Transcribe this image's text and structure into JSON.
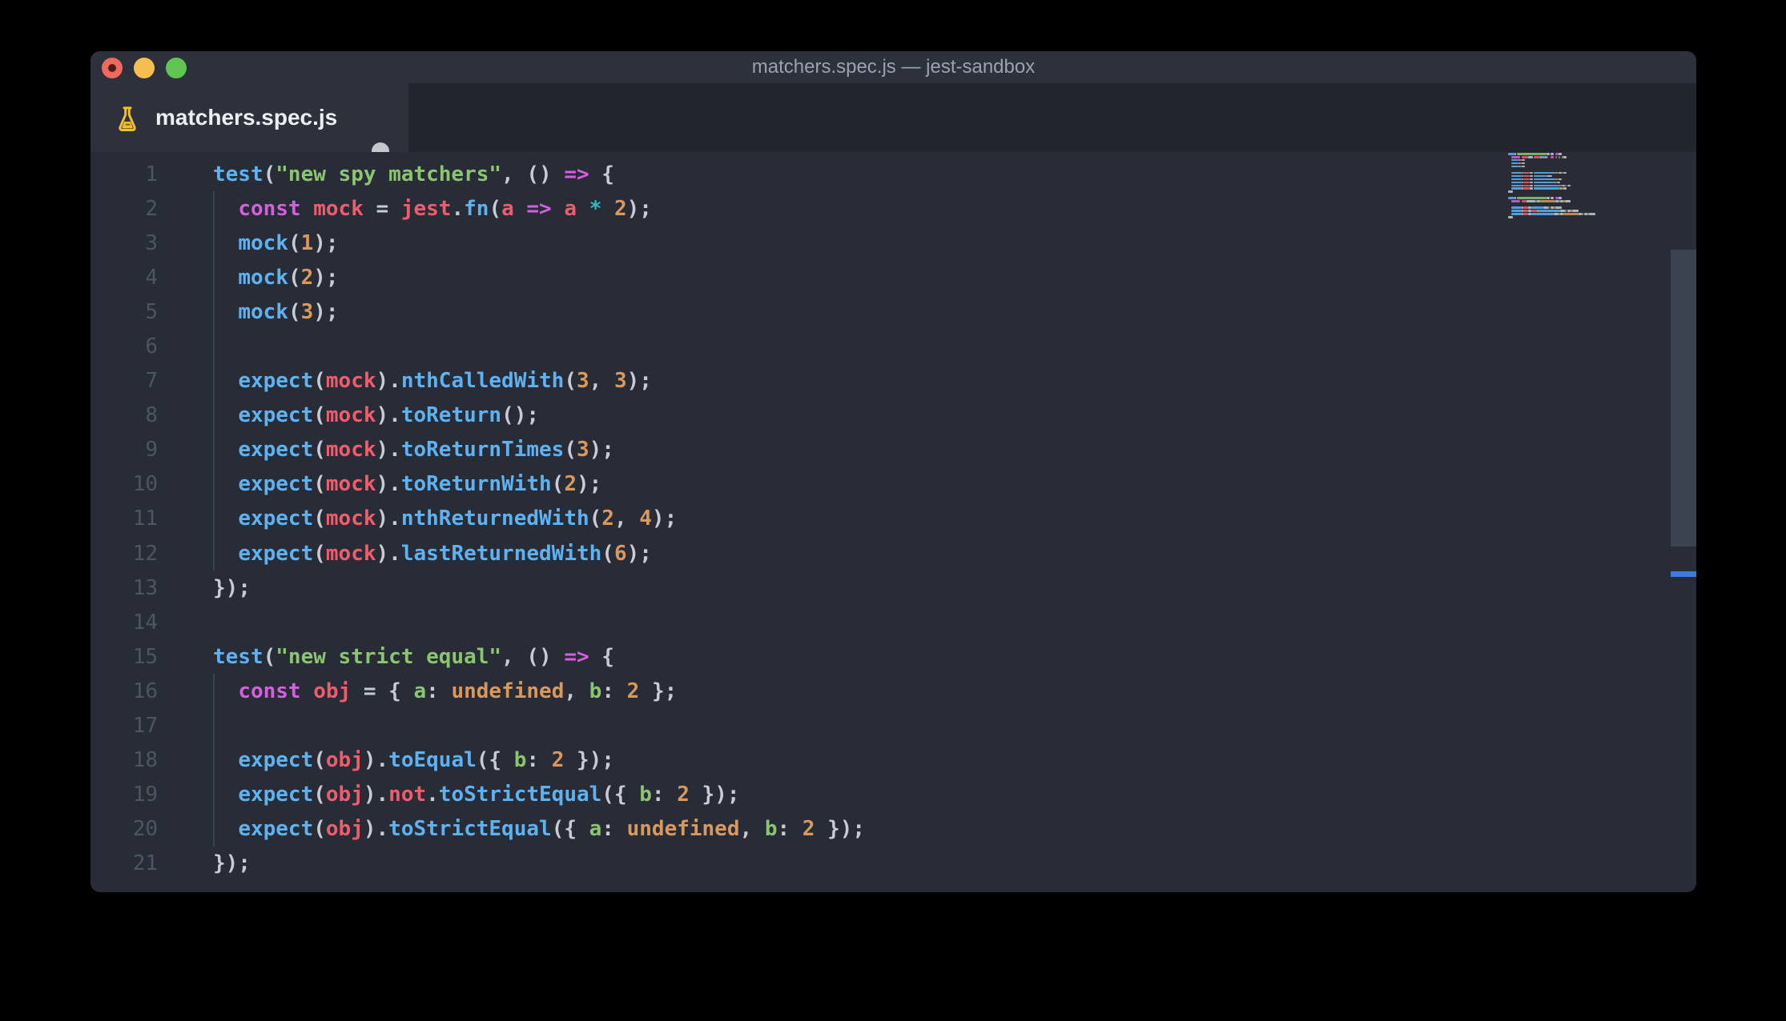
{
  "window": {
    "title": "matchers.spec.js — jest-sandbox"
  },
  "traffic_lights": {
    "close": "#ed6a5f",
    "close_dot": "#531b13",
    "minimize": "#f5bf4f",
    "zoom": "#61c554"
  },
  "tab": {
    "label": "matchers.spec.js",
    "icon": "flask-test-icon",
    "modified": true
  },
  "toolbar": {
    "actions": [
      {
        "name": "open-preview",
        "icon": "file-search-icon"
      },
      {
        "name": "split-editor",
        "icon": "split-editor-icon"
      },
      {
        "name": "more-actions",
        "icon": "ellipsis-icon"
      }
    ]
  },
  "colors": {
    "kw": "#d55fde",
    "fn": "#5fb2f2",
    "str": "#8bc56f",
    "var": "#ef5d6d",
    "num": "#d9995d",
    "op": "#35b8c8",
    "pun": "#c6cbd4",
    "key": "#8bc56f",
    "line_number": "#4d5565",
    "guide": "#3a4150",
    "editor_bg": "#272c36",
    "chrome_bg": "#2c313c",
    "tabbar_bg": "#21252d",
    "accent_overview": "#3d79e0",
    "tl_red": "#ed6a5f",
    "tl_red_dot": "#531b13",
    "tl_yellow": "#f5bf4f",
    "tl_green": "#61c554"
  },
  "editor": {
    "lines": [
      {
        "n": 1,
        "guide": false,
        "tokens": [
          [
            "test",
            "fn"
          ],
          [
            "(",
            "pun"
          ],
          [
            "\"new spy matchers\"",
            "str"
          ],
          [
            ", ",
            "pun"
          ],
          [
            "()",
            "pun"
          ],
          [
            " ",
            "pun"
          ],
          [
            "=>",
            "kw"
          ],
          [
            " {",
            "pun"
          ]
        ]
      },
      {
        "n": 2,
        "guide": true,
        "tokens": [
          [
            "  ",
            "pun"
          ],
          [
            "const",
            "kw"
          ],
          [
            " ",
            "pun"
          ],
          [
            "mock",
            "var"
          ],
          [
            " = ",
            "pun"
          ],
          [
            "jest",
            "var"
          ],
          [
            ".",
            "pun"
          ],
          [
            "fn",
            "fn"
          ],
          [
            "(",
            "pun"
          ],
          [
            "a",
            "var"
          ],
          [
            " ",
            "pun"
          ],
          [
            "=>",
            "kw"
          ],
          [
            " ",
            "pun"
          ],
          [
            "a",
            "var"
          ],
          [
            " ",
            "pun"
          ],
          [
            "*",
            "op"
          ],
          [
            " ",
            "pun"
          ],
          [
            "2",
            "num"
          ],
          [
            ");",
            "pun"
          ]
        ]
      },
      {
        "n": 3,
        "guide": true,
        "tokens": [
          [
            "  ",
            "pun"
          ],
          [
            "mock",
            "fn"
          ],
          [
            "(",
            "pun"
          ],
          [
            "1",
            "num"
          ],
          [
            ");",
            "pun"
          ]
        ]
      },
      {
        "n": 4,
        "guide": true,
        "tokens": [
          [
            "  ",
            "pun"
          ],
          [
            "mock",
            "fn"
          ],
          [
            "(",
            "pun"
          ],
          [
            "2",
            "num"
          ],
          [
            ");",
            "pun"
          ]
        ]
      },
      {
        "n": 5,
        "guide": true,
        "tokens": [
          [
            "  ",
            "pun"
          ],
          [
            "mock",
            "fn"
          ],
          [
            "(",
            "pun"
          ],
          [
            "3",
            "num"
          ],
          [
            ");",
            "pun"
          ]
        ]
      },
      {
        "n": 6,
        "guide": true,
        "tokens": []
      },
      {
        "n": 7,
        "guide": true,
        "tokens": [
          [
            "  ",
            "pun"
          ],
          [
            "expect",
            "fn"
          ],
          [
            "(",
            "pun"
          ],
          [
            "mock",
            "var"
          ],
          [
            ").",
            "pun"
          ],
          [
            "nthCalledWith",
            "fn"
          ],
          [
            "(",
            "pun"
          ],
          [
            "3",
            "num"
          ],
          [
            ", ",
            "pun"
          ],
          [
            "3",
            "num"
          ],
          [
            ");",
            "pun"
          ]
        ]
      },
      {
        "n": 8,
        "guide": true,
        "tokens": [
          [
            "  ",
            "pun"
          ],
          [
            "expect",
            "fn"
          ],
          [
            "(",
            "pun"
          ],
          [
            "mock",
            "var"
          ],
          [
            ").",
            "pun"
          ],
          [
            "toReturn",
            "fn"
          ],
          [
            "();",
            "pun"
          ]
        ]
      },
      {
        "n": 9,
        "guide": true,
        "tokens": [
          [
            "  ",
            "pun"
          ],
          [
            "expect",
            "fn"
          ],
          [
            "(",
            "pun"
          ],
          [
            "mock",
            "var"
          ],
          [
            ").",
            "pun"
          ],
          [
            "toReturnTimes",
            "fn"
          ],
          [
            "(",
            "pun"
          ],
          [
            "3",
            "num"
          ],
          [
            ");",
            "pun"
          ]
        ]
      },
      {
        "n": 10,
        "guide": true,
        "tokens": [
          [
            "  ",
            "pun"
          ],
          [
            "expect",
            "fn"
          ],
          [
            "(",
            "pun"
          ],
          [
            "mock",
            "var"
          ],
          [
            ").",
            "pun"
          ],
          [
            "toReturnWith",
            "fn"
          ],
          [
            "(",
            "pun"
          ],
          [
            "2",
            "num"
          ],
          [
            ");",
            "pun"
          ]
        ]
      },
      {
        "n": 11,
        "guide": true,
        "tokens": [
          [
            "  ",
            "pun"
          ],
          [
            "expect",
            "fn"
          ],
          [
            "(",
            "pun"
          ],
          [
            "mock",
            "var"
          ],
          [
            ").",
            "pun"
          ],
          [
            "nthReturnedWith",
            "fn"
          ],
          [
            "(",
            "pun"
          ],
          [
            "2",
            "num"
          ],
          [
            ", ",
            "pun"
          ],
          [
            "4",
            "num"
          ],
          [
            ");",
            "pun"
          ]
        ]
      },
      {
        "n": 12,
        "guide": true,
        "tokens": [
          [
            "  ",
            "pun"
          ],
          [
            "expect",
            "fn"
          ],
          [
            "(",
            "pun"
          ],
          [
            "mock",
            "var"
          ],
          [
            ").",
            "pun"
          ],
          [
            "lastReturnedWith",
            "fn"
          ],
          [
            "(",
            "pun"
          ],
          [
            "6",
            "num"
          ],
          [
            ");",
            "pun"
          ]
        ]
      },
      {
        "n": 13,
        "guide": false,
        "tokens": [
          [
            "});",
            "pun"
          ]
        ]
      },
      {
        "n": 14,
        "guide": false,
        "tokens": []
      },
      {
        "n": 15,
        "guide": false,
        "tokens": [
          [
            "test",
            "fn"
          ],
          [
            "(",
            "pun"
          ],
          [
            "\"new strict equal\"",
            "str"
          ],
          [
            ", ",
            "pun"
          ],
          [
            "()",
            "pun"
          ],
          [
            " ",
            "pun"
          ],
          [
            "=>",
            "kw"
          ],
          [
            " {",
            "pun"
          ]
        ]
      },
      {
        "n": 16,
        "guide": true,
        "tokens": [
          [
            "  ",
            "pun"
          ],
          [
            "const",
            "kw"
          ],
          [
            " ",
            "pun"
          ],
          [
            "obj",
            "var"
          ],
          [
            " = { ",
            "pun"
          ],
          [
            "a",
            "key"
          ],
          [
            ": ",
            "pun"
          ],
          [
            "undefined",
            "num"
          ],
          [
            ", ",
            "pun"
          ],
          [
            "b",
            "key"
          ],
          [
            ": ",
            "pun"
          ],
          [
            "2",
            "num"
          ],
          [
            " };",
            "pun"
          ]
        ]
      },
      {
        "n": 17,
        "guide": true,
        "tokens": []
      },
      {
        "n": 18,
        "guide": true,
        "tokens": [
          [
            "  ",
            "pun"
          ],
          [
            "expect",
            "fn"
          ],
          [
            "(",
            "pun"
          ],
          [
            "obj",
            "var"
          ],
          [
            ").",
            "pun"
          ],
          [
            "toEqual",
            "fn"
          ],
          [
            "({ ",
            "pun"
          ],
          [
            "b",
            "key"
          ],
          [
            ": ",
            "pun"
          ],
          [
            "2",
            "num"
          ],
          [
            " });",
            "pun"
          ]
        ]
      },
      {
        "n": 19,
        "guide": true,
        "tokens": [
          [
            "  ",
            "pun"
          ],
          [
            "expect",
            "fn"
          ],
          [
            "(",
            "pun"
          ],
          [
            "obj",
            "var"
          ],
          [
            ").",
            "pun"
          ],
          [
            "not",
            "var"
          ],
          [
            ".",
            "pun"
          ],
          [
            "toStrictEqual",
            "fn"
          ],
          [
            "({ ",
            "pun"
          ],
          [
            "b",
            "key"
          ],
          [
            ": ",
            "pun"
          ],
          [
            "2",
            "num"
          ],
          [
            " });",
            "pun"
          ]
        ]
      },
      {
        "n": 20,
        "guide": true,
        "tokens": [
          [
            "  ",
            "pun"
          ],
          [
            "expect",
            "fn"
          ],
          [
            "(",
            "pun"
          ],
          [
            "obj",
            "var"
          ],
          [
            ").",
            "pun"
          ],
          [
            "toStrictEqual",
            "fn"
          ],
          [
            "({ ",
            "pun"
          ],
          [
            "a",
            "key"
          ],
          [
            ": ",
            "pun"
          ],
          [
            "undefined",
            "num"
          ],
          [
            ", ",
            "pun"
          ],
          [
            "b",
            "key"
          ],
          [
            ": ",
            "pun"
          ],
          [
            "2",
            "num"
          ],
          [
            " });",
            "pun"
          ]
        ]
      },
      {
        "n": 21,
        "guide": false,
        "tokens": [
          [
            "});",
            "pun"
          ]
        ]
      }
    ]
  }
}
